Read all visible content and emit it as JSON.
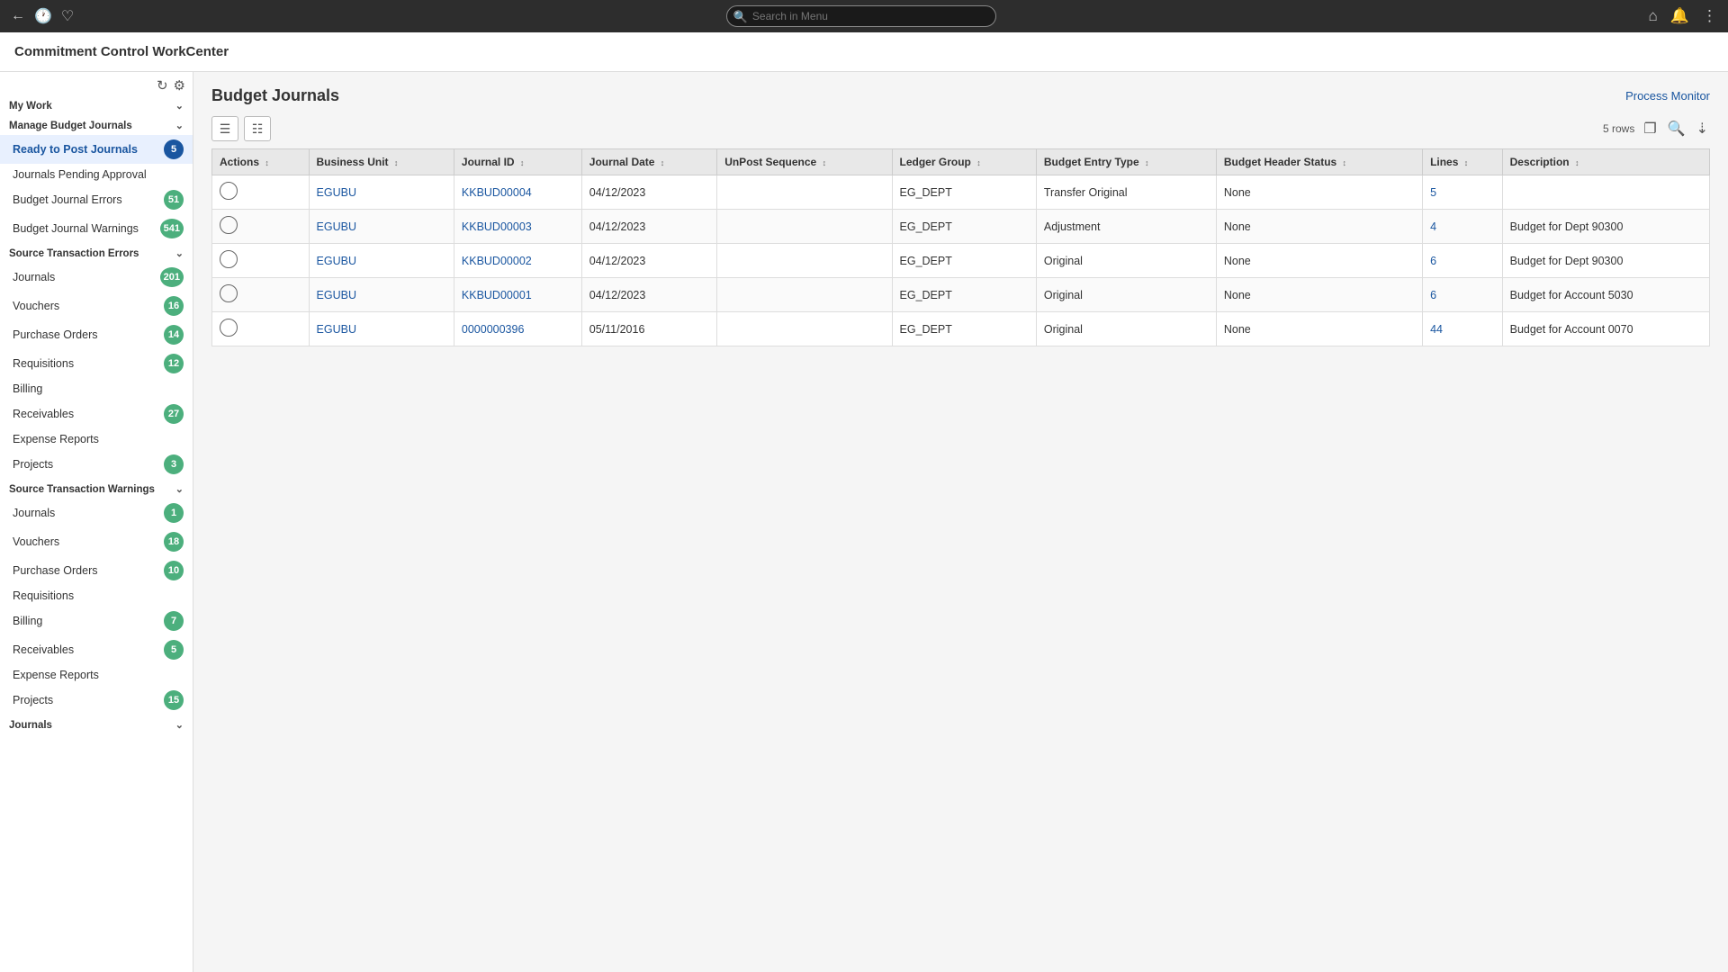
{
  "topbar": {
    "search_placeholder": "Search in Menu",
    "icons": {
      "back": "←",
      "history": "🕐",
      "bookmark": "♡",
      "home": "⌂",
      "bell": "🔔",
      "more": "⋮"
    }
  },
  "app_title": "Commitment Control WorkCenter",
  "sidebar": {
    "refresh_icon": "↻",
    "settings_icon": "⚙",
    "my_work_label": "My Work",
    "sections": [
      {
        "id": "manage_budget",
        "label": "Manage Budget Journals",
        "collapsible": true,
        "items": [
          {
            "id": "ready_to_post",
            "label": "Ready to Post Journals",
            "badge": "5",
            "active": true
          },
          {
            "id": "journals_pending",
            "label": "Journals Pending Approval",
            "badge": null
          },
          {
            "id": "budget_journal_errors",
            "label": "Budget Journal Errors",
            "badge": "51"
          },
          {
            "id": "budget_journal_warnings",
            "label": "Budget Journal Warnings",
            "badge": "541"
          }
        ]
      },
      {
        "id": "source_transaction_errors",
        "label": "Source Transaction Errors",
        "collapsible": true,
        "items": [
          {
            "id": "journals_errors",
            "label": "Journals",
            "badge": "201"
          },
          {
            "id": "vouchers_errors",
            "label": "Vouchers",
            "badge": "16"
          },
          {
            "id": "purchase_orders_errors",
            "label": "Purchase Orders",
            "badge": "14"
          },
          {
            "id": "requisitions_errors",
            "label": "Requisitions",
            "badge": "12"
          },
          {
            "id": "billing_errors",
            "label": "Billing",
            "badge": null
          },
          {
            "id": "receivables_errors",
            "label": "Receivables",
            "badge": "27"
          },
          {
            "id": "expense_reports_errors",
            "label": "Expense Reports",
            "badge": null
          },
          {
            "id": "projects_errors",
            "label": "Projects",
            "badge": "3"
          }
        ]
      },
      {
        "id": "source_transaction_warnings",
        "label": "Source Transaction Warnings",
        "collapsible": true,
        "items": [
          {
            "id": "journals_warnings",
            "label": "Journals",
            "badge": "1"
          },
          {
            "id": "vouchers_warnings",
            "label": "Vouchers",
            "badge": "18"
          },
          {
            "id": "purchase_orders_warnings",
            "label": "Purchase Orders",
            "badge": "10"
          },
          {
            "id": "requisitions_warnings",
            "label": "Requisitions",
            "badge": null
          },
          {
            "id": "billing_warnings",
            "label": "Billing",
            "badge": "7"
          },
          {
            "id": "receivables_warnings",
            "label": "Receivables",
            "badge": "5"
          },
          {
            "id": "expense_reports_warnings",
            "label": "Expense Reports",
            "badge": null
          },
          {
            "id": "projects_warnings",
            "label": "Projects",
            "badge": "15"
          }
        ]
      },
      {
        "id": "journals_section",
        "label": "Journals",
        "collapsible": true,
        "items": []
      }
    ]
  },
  "main": {
    "page_title": "Budget Journals",
    "process_monitor": "Process Monitor",
    "rows_count": "5 rows",
    "table": {
      "columns": [
        {
          "id": "actions",
          "label": "Actions"
        },
        {
          "id": "business_unit",
          "label": "Business Unit"
        },
        {
          "id": "journal_id",
          "label": "Journal ID"
        },
        {
          "id": "journal_date",
          "label": "Journal Date"
        },
        {
          "id": "unpost_sequence",
          "label": "UnPost Sequence"
        },
        {
          "id": "ledger_group",
          "label": "Ledger Group"
        },
        {
          "id": "budget_entry_type",
          "label": "Budget Entry Type"
        },
        {
          "id": "budget_header_status",
          "label": "Budget Header Status"
        },
        {
          "id": "lines",
          "label": "Lines"
        },
        {
          "id": "description",
          "label": "Description"
        }
      ],
      "rows": [
        {
          "actions": "○",
          "business_unit": "EGUBU",
          "journal_id": "KKBUD00004",
          "journal_date": "04/12/2023",
          "unpost_sequence": "",
          "ledger_group": "EG_DEPT",
          "budget_entry_type": "Transfer Original",
          "budget_header_status": "None",
          "lines": "5",
          "description": ""
        },
        {
          "actions": "○",
          "business_unit": "EGUBU",
          "journal_id": "KKBUD00003",
          "journal_date": "04/12/2023",
          "unpost_sequence": "",
          "ledger_group": "EG_DEPT",
          "budget_entry_type": "Adjustment",
          "budget_header_status": "None",
          "lines": "4",
          "description": "Budget for Dept 90300"
        },
        {
          "actions": "○",
          "business_unit": "EGUBU",
          "journal_id": "KKBUD00002",
          "journal_date": "04/12/2023",
          "unpost_sequence": "",
          "ledger_group": "EG_DEPT",
          "budget_entry_type": "Original",
          "budget_header_status": "None",
          "lines": "6",
          "description": "Budget for Dept 90300"
        },
        {
          "actions": "○",
          "business_unit": "EGUBU",
          "journal_id": "KKBUD00001",
          "journal_date": "04/12/2023",
          "unpost_sequence": "",
          "ledger_group": "EG_DEPT",
          "budget_entry_type": "Original",
          "budget_header_status": "None",
          "lines": "6",
          "description": "Budget for Account 5030"
        },
        {
          "actions": "○",
          "business_unit": "EGUBU",
          "journal_id": "0000000396",
          "journal_date": "05/11/2016",
          "unpost_sequence": "",
          "ledger_group": "EG_DEPT",
          "budget_entry_type": "Original",
          "budget_header_status": "None",
          "lines": "44",
          "description": "Budget for Account 0070"
        }
      ]
    }
  }
}
